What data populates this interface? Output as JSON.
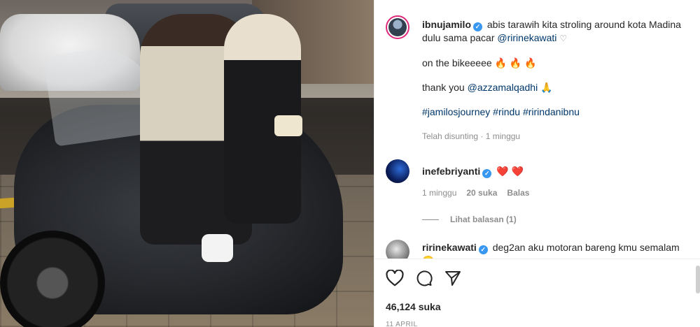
{
  "post": {
    "author": "ibnujamilo",
    "caption_line1_a": "abis tarawih kita stroling around kota Madina dulu sama pacar",
    "caption_line1_mention": "@ririnekawati",
    "caption_line2": "on the bikeeeee",
    "caption_line3": "thank you",
    "caption_line3_mention": "@azzamalqadhi",
    "hashtags": "#jamilosjourney #rindu #ririndanibnu",
    "edited_meta": "Telah disunting · 1 minggu"
  },
  "comments": [
    {
      "user": "inefebriyanti",
      "text": "",
      "time": "1 minggu",
      "likes": "20 suka",
      "reply": "Balas",
      "view_replies": "Lihat balasan (1)"
    },
    {
      "user": "ririnekawati",
      "text": "deg2an aku motoran bareng kmu semalam"
    }
  ],
  "footer": {
    "likes": "46,124 suka",
    "date": "11 APRIL"
  },
  "icons": {
    "like": "heart-outline-icon",
    "comment": "speech-bubble-icon",
    "share": "paper-plane-icon",
    "verified": "verified-badge-icon"
  },
  "colors": {
    "verified": "#3897f0",
    "mention": "#00376b",
    "muted": "#8e8e8e",
    "heart": "#ed1c3b"
  }
}
